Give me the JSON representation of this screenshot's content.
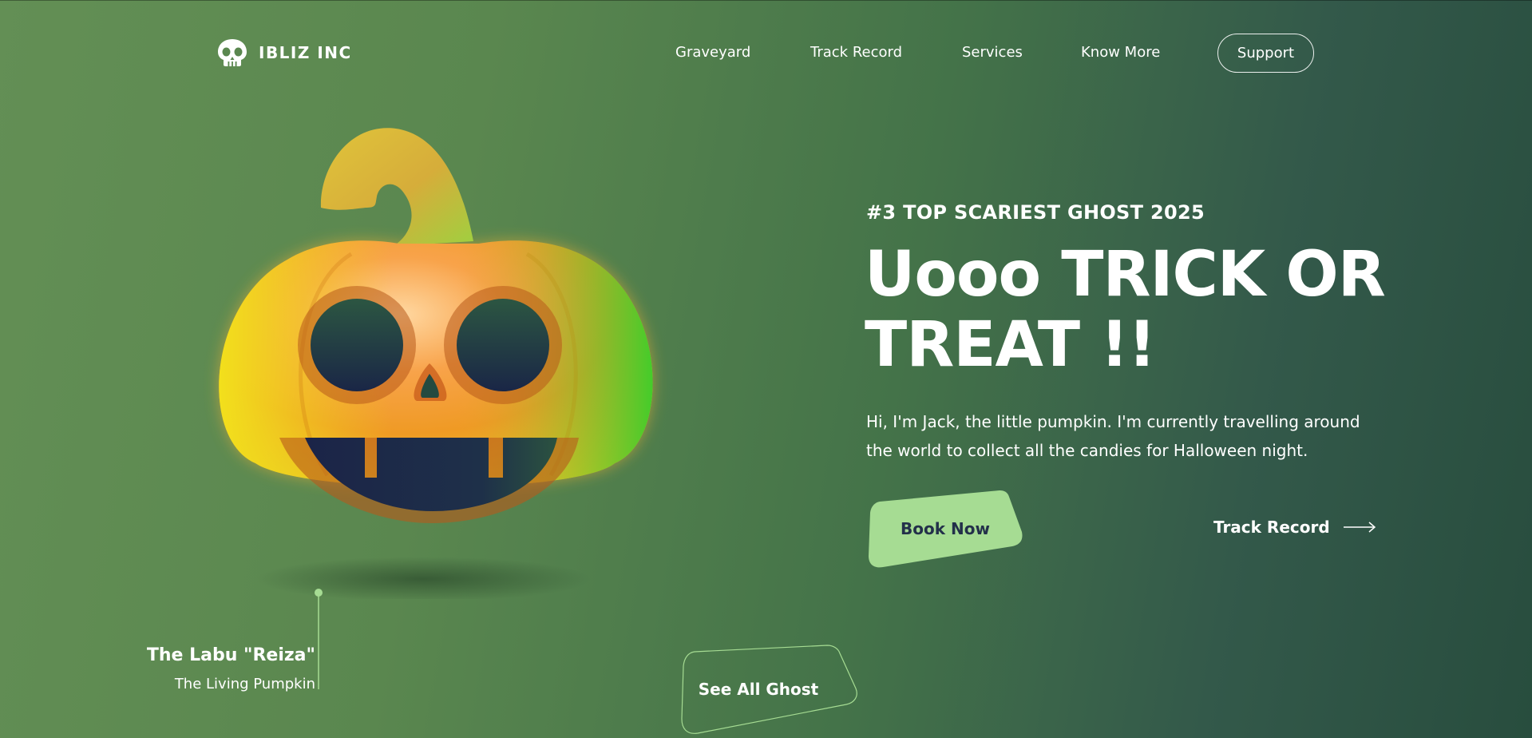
{
  "brand": {
    "name": "IBLIZ INC",
    "icon": "skull-icon"
  },
  "nav": {
    "items": [
      "Graveyard",
      "Track Record",
      "Services",
      "Know More"
    ],
    "support_label": "Support"
  },
  "hero": {
    "eyebrow": "#3 TOP SCARIEST GHOST 2025",
    "title_line1": "Uooo TRICK OR",
    "title_line2": "TREAT !!",
    "description": "Hi, I'm Jack, the little pumpkin. I'm currently travelling around the world to collect all the candies for Halloween night.",
    "book_label": "Book Now",
    "track_label": "Track Record",
    "track_icon": "arrow-right-icon"
  },
  "character": {
    "name": "The Labu \"Reiza\"",
    "subtitle": "The Living Pumpkin",
    "image_icon": "jack-o-lantern-icon"
  },
  "see_all_label": "See All Ghost",
  "colors": {
    "accent": "#a6dc93",
    "button_text": "#23304a",
    "background_start": "#638f55",
    "background_end": "#284d3e"
  }
}
